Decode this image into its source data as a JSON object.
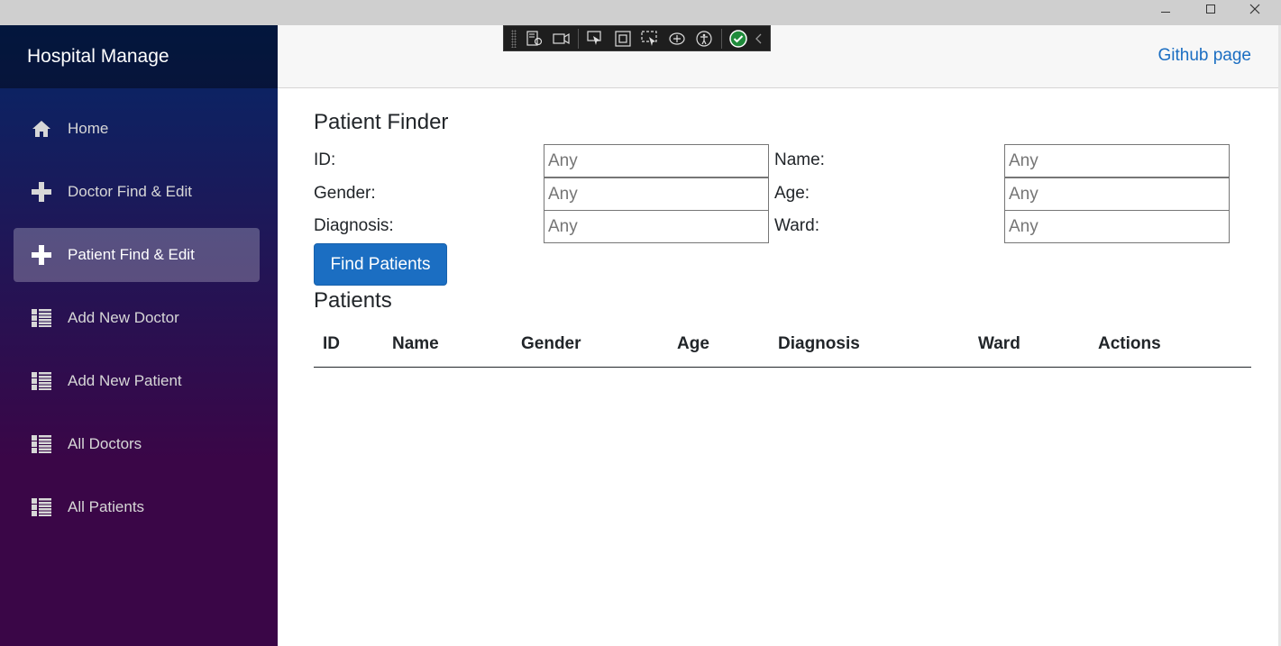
{
  "window": {
    "minimize_icon": "minimize-icon",
    "maximize_icon": "maximize-icon",
    "close_icon": "close-icon"
  },
  "sidebar": {
    "brand": "Hospital Manage",
    "items": [
      {
        "label": "Home",
        "icon": "home-icon",
        "active": false
      },
      {
        "label": "Doctor Find & Edit",
        "icon": "plus-icon",
        "active": false
      },
      {
        "label": "Patient Find & Edit",
        "icon": "plus-icon",
        "active": true
      },
      {
        "label": "Add New Doctor",
        "icon": "list-rich-icon",
        "active": false
      },
      {
        "label": "Add New Patient",
        "icon": "list-rich-icon",
        "active": false
      },
      {
        "label": "All Doctors",
        "icon": "list-rich-icon",
        "active": false
      },
      {
        "label": "All Patients",
        "icon": "list-rich-icon",
        "active": false
      }
    ]
  },
  "header": {
    "github_link": "Github page"
  },
  "finder": {
    "title": "Patient Finder",
    "fields": {
      "id": {
        "label": "ID:",
        "placeholder": "Any",
        "value": ""
      },
      "name": {
        "label": "Name:",
        "placeholder": "Any",
        "value": ""
      },
      "gender": {
        "label": "Gender:",
        "placeholder": "Any",
        "value": ""
      },
      "age": {
        "label": "Age:",
        "placeholder": "Any",
        "value": ""
      },
      "diagnosis": {
        "label": "Diagnosis:",
        "placeholder": "Any",
        "value": ""
      },
      "ward": {
        "label": "Ward:",
        "placeholder": "Any",
        "value": ""
      }
    },
    "button_label": "Find Patients"
  },
  "patients": {
    "title": "Patients",
    "columns": [
      "ID",
      "Name",
      "Gender",
      "Age",
      "Diagnosis",
      "Ward",
      "Actions"
    ],
    "rows": []
  },
  "colors": {
    "accent": "#1b6ec2",
    "sidebar_top": "#052767",
    "sidebar_bottom": "#3a0647"
  }
}
